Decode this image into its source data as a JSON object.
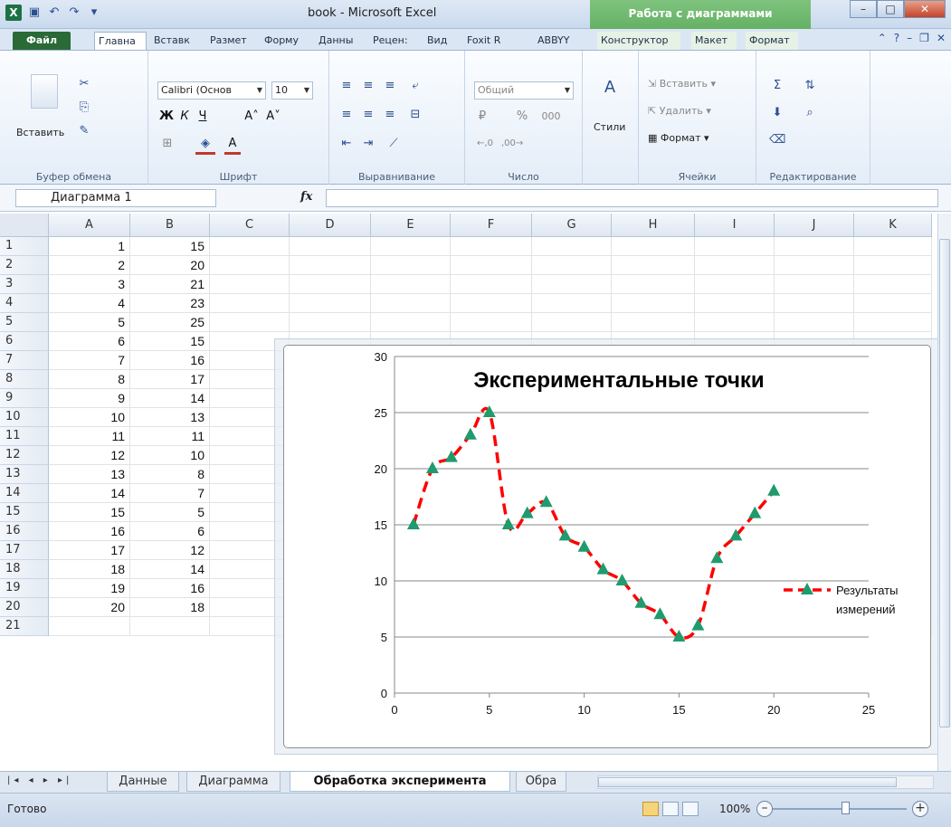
{
  "window": {
    "title": "book - Microsoft Excel",
    "contextual_group": "Работа с диаграммами"
  },
  "ribbon_tabs": [
    {
      "id": "file",
      "label": "Файл"
    },
    {
      "id": "home",
      "label": "Главна"
    },
    {
      "id": "insert",
      "label": "Вставк"
    },
    {
      "id": "layout",
      "label": "Размет"
    },
    {
      "id": "formulas",
      "label": "Форму"
    },
    {
      "id": "data",
      "label": "Данны"
    },
    {
      "id": "review",
      "label": "Рецен:"
    },
    {
      "id": "view",
      "label": "Вид"
    },
    {
      "id": "foxit",
      "label": "Foxit R"
    },
    {
      "id": "abbyy",
      "label": "ABBYY"
    },
    {
      "id": "design",
      "label": "Конструктор"
    },
    {
      "id": "chartlayout",
      "label": "Макет"
    },
    {
      "id": "format",
      "label": "Формат"
    }
  ],
  "ribbon": {
    "clipboard": {
      "paste": "Вставить",
      "label": "Буфер обмена"
    },
    "font": {
      "name": "Calibri (Основ",
      "size": "10",
      "label": "Шрифт"
    },
    "alignment": {
      "label": "Выравнивание"
    },
    "number": {
      "format": "Общий",
      "label": "Число"
    },
    "styles": {
      "label": "Стили"
    },
    "cells": {
      "insert": "Вставить",
      "delete": "Удалить",
      "format": "Формат",
      "label": "Ячейки"
    },
    "editing": {
      "label": "Редактирование"
    }
  },
  "formula_bar": {
    "name_box": "Диаграмма 1",
    "fx": "fx",
    "formula": ""
  },
  "columns": [
    "A",
    "B",
    "C",
    "D",
    "E",
    "F",
    "G",
    "H",
    "I",
    "J",
    "K"
  ],
  "rows": [
    "1",
    "2",
    "3",
    "4",
    "5",
    "6",
    "7",
    "8",
    "9",
    "10",
    "11",
    "12",
    "13",
    "14",
    "15",
    "16",
    "17",
    "18",
    "19",
    "20",
    "21"
  ],
  "sheet_data": {
    "A": [
      "1",
      "2",
      "3",
      "4",
      "5",
      "6",
      "7",
      "8",
      "9",
      "10",
      "11",
      "12",
      "13",
      "14",
      "15",
      "16",
      "17",
      "18",
      "19",
      "20"
    ],
    "B": [
      "15",
      "20",
      "21",
      "23",
      "25",
      "15",
      "16",
      "17",
      "14",
      "13",
      "11",
      "10",
      "8",
      "7",
      "5",
      "6",
      "12",
      "14",
      "16",
      "18"
    ]
  },
  "chart_data": {
    "type": "line",
    "title": "Экспериментальные точки",
    "x": [
      1,
      2,
      3,
      4,
      5,
      6,
      7,
      8,
      9,
      10,
      11,
      12,
      13,
      14,
      15,
      16,
      17,
      18,
      19,
      20
    ],
    "series": [
      {
        "name": "Результаты измерений",
        "values": [
          15,
          20,
          21,
          23,
          25,
          15,
          16,
          17,
          14,
          13,
          11,
          10,
          8,
          7,
          5,
          6,
          12,
          14,
          16,
          18
        ],
        "line_color": "#ff0000",
        "marker_color": "#1f9b6d",
        "line_style": "dashed",
        "marker": "triangle"
      }
    ],
    "xlim": [
      0,
      25
    ],
    "ylim": [
      0,
      30
    ],
    "xticks": [
      "0",
      "5",
      "10",
      "15",
      "20",
      "25"
    ],
    "yticks": [
      "0",
      "5",
      "10",
      "15",
      "20",
      "25",
      "30"
    ],
    "grid": true,
    "legend": "right",
    "legend_lines": [
      "Результаты",
      "измерений"
    ]
  },
  "sheet_tabs": [
    {
      "label": "Данные",
      "active": false
    },
    {
      "label": "Диаграмма",
      "active": false
    },
    {
      "label": "Обработка эксперимента",
      "active": true
    },
    {
      "label": "Обра",
      "active": false
    }
  ],
  "status": {
    "text": "Готово",
    "zoom": "100%"
  }
}
